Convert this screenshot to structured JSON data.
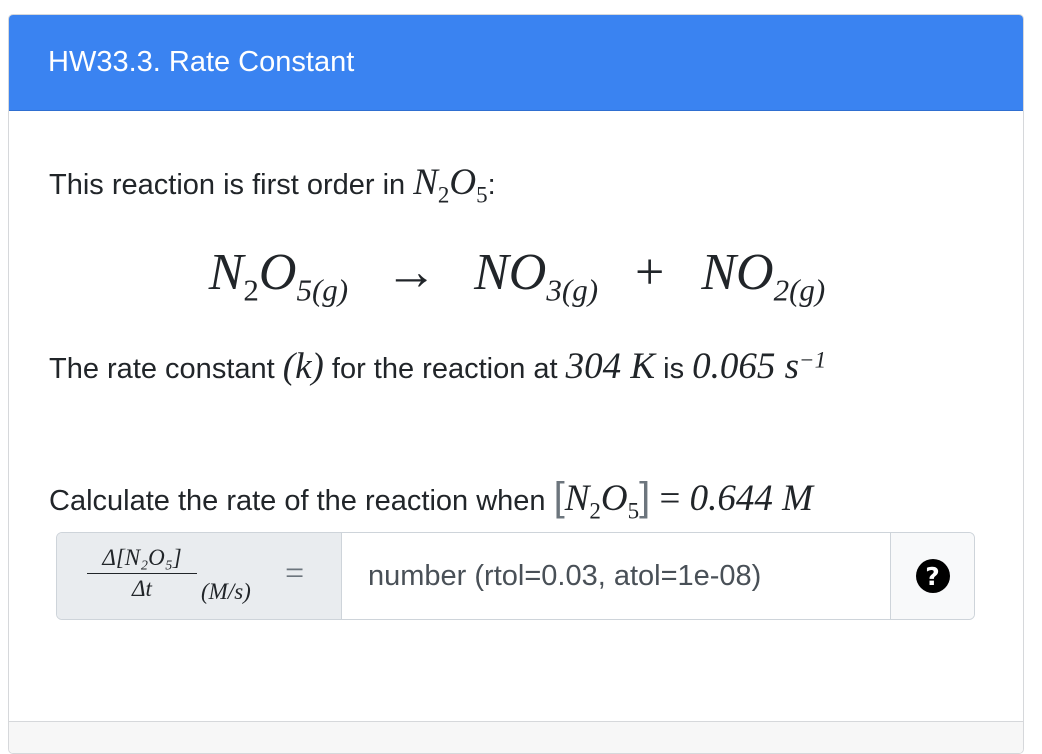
{
  "header": {
    "title": "HW33.3. Rate Constant"
  },
  "question": {
    "intro_text": "This reaction is first order in ",
    "intro_species": "N",
    "intro_sub1": "2",
    "intro_o": "O",
    "intro_sub2": "5",
    "intro_colon": ":",
    "equation": {
      "reactant": "N",
      "reactant_sub1": "2",
      "reactant_o": "O",
      "reactant_sub2": "5(g)",
      "arrow": "→",
      "product1": "NO",
      "product1_sub": "3(g)",
      "plus": "+",
      "product2": "NO",
      "product2_sub": "2(g)"
    },
    "rate_text_1": "The rate constant ",
    "rate_symbol": "(k)",
    "rate_text_2": " for the reaction at ",
    "temperature": "304 K",
    "rate_text_3": " is ",
    "rate_value": "0.065 s",
    "rate_exponent": "−1",
    "calc_text": "Calculate the rate of the reaction when ",
    "conc_open": "[",
    "conc_species": "N",
    "conc_sub1": "2",
    "conc_o": "O",
    "conc_sub2": "5",
    "conc_close": "]",
    "conc_eq": " = ",
    "conc_value": "0.644 M"
  },
  "answer": {
    "frac_num": "Δ[N₂O₅]",
    "frac_den": "Δt",
    "units": "(M/s)",
    "equals": "=",
    "placeholder": "number (rtol=0.03, atol=1e-08)",
    "help_glyph": "?"
  }
}
